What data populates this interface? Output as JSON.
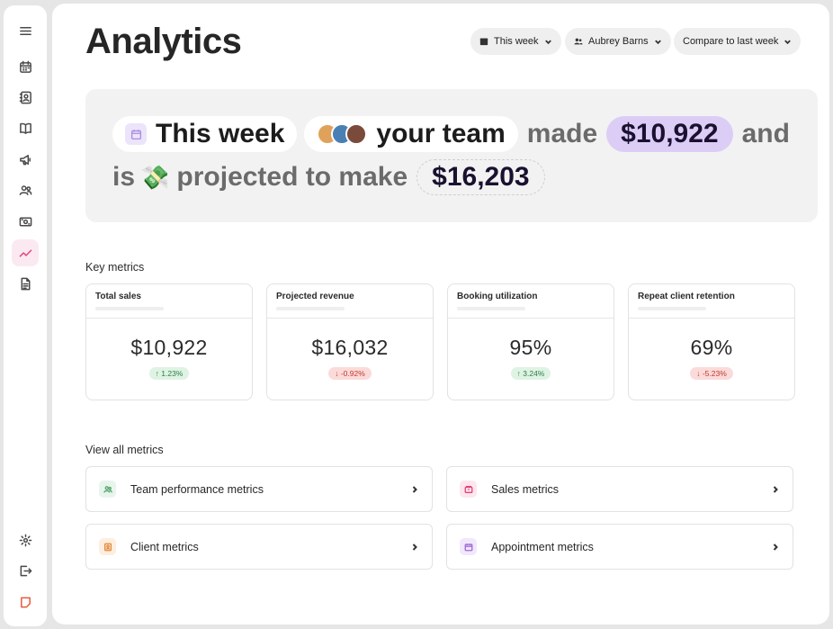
{
  "sidebar": {
    "items": [
      {
        "name": "menu-icon"
      },
      {
        "name": "calendar-icon"
      },
      {
        "name": "contacts-icon"
      },
      {
        "name": "book-icon"
      },
      {
        "name": "megaphone-icon"
      },
      {
        "name": "team-icon"
      },
      {
        "name": "money-icon"
      },
      {
        "name": "analytics-icon",
        "active": true
      },
      {
        "name": "document-icon"
      },
      {
        "name": "settings-icon"
      },
      {
        "name": "logout-icon"
      },
      {
        "name": "brand-logo-icon"
      }
    ]
  },
  "header": {
    "title": "Analytics",
    "filters": {
      "period": "This week",
      "member": "Aubrey Barns",
      "compare": "Compare to last week"
    }
  },
  "hero": {
    "period": "This week",
    "subject": "your team",
    "made_word": "made",
    "made_amount": "$10,922",
    "and_word": "and",
    "is_word": "is",
    "projected_text": "projected to make",
    "projected_amount": "$16,203"
  },
  "key_metrics": {
    "title": "Key metrics",
    "cards": [
      {
        "label": "Total sales",
        "value": "$10,922",
        "delta": "↑ 1.23%",
        "trend": "up"
      },
      {
        "label": "Projected revenue",
        "value": "$16,032",
        "delta": "↓ -0.92%",
        "trend": "down"
      },
      {
        "label": "Booking utilization",
        "value": "95%",
        "delta": "↑ 3.24%",
        "trend": "up"
      },
      {
        "label": "Repeat client retention",
        "value": "69%",
        "delta": "↓ -5.23%",
        "trend": "down"
      }
    ]
  },
  "all_metrics": {
    "title": "View all metrics",
    "links": [
      {
        "label": "Team performance metrics",
        "icon": "team-icon",
        "color": "#e8f5ec"
      },
      {
        "label": "Sales metrics",
        "icon": "wallet-icon",
        "color": "#fde6ee"
      },
      {
        "label": "Client metrics",
        "icon": "client-icon",
        "color": "#fdeedd"
      },
      {
        "label": "Appointment metrics",
        "icon": "calendar-icon",
        "color": "#f1e8fb"
      }
    ]
  },
  "colors": {
    "accent_pink": "#e0457b",
    "money_chip": "#dccdf6",
    "up_green": "#2f7d45",
    "down_red": "#c0392b"
  }
}
